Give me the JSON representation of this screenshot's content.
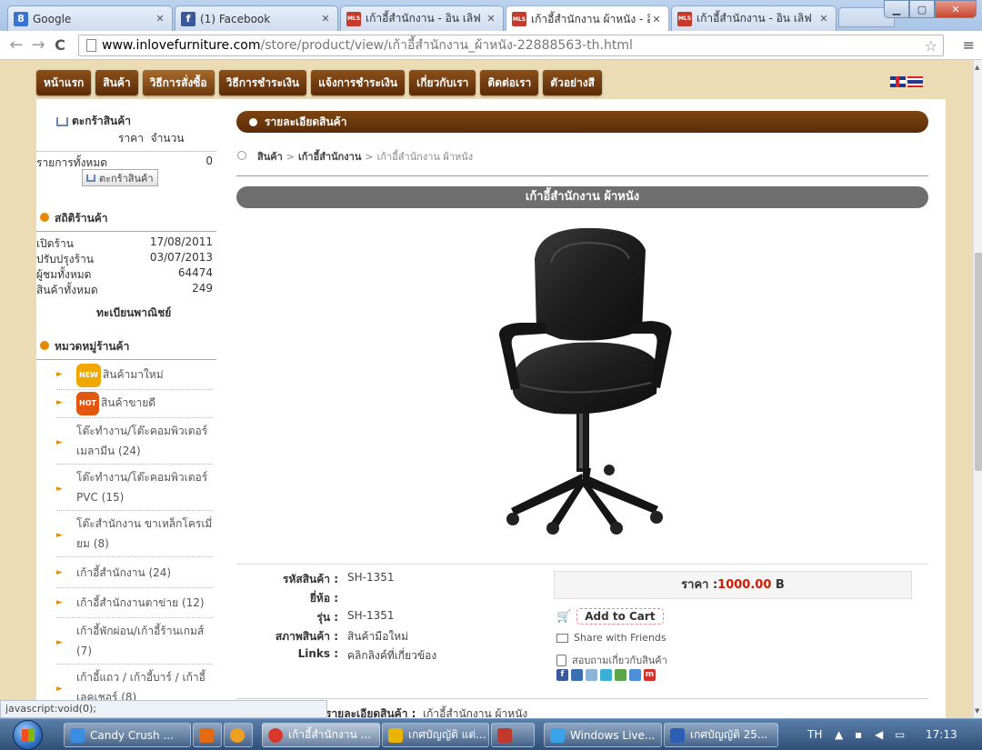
{
  "browser": {
    "tabs": [
      {
        "title": "Google",
        "fav_text": "8",
        "fav_color": "#3b73d1"
      },
      {
        "title": "(1) Facebook",
        "fav_text": "f",
        "fav_color": "#3b5998"
      },
      {
        "title": "เก้าอี้สำนักงาน - อิน เลิฟ",
        "fav_text": "MLS",
        "fav_color": "#c53a2a"
      },
      {
        "title": "เก้าอี้สำนักงาน ผ้าหนัง - อิ",
        "fav_text": "MLS",
        "fav_color": "#c53a2a"
      },
      {
        "title": "เก้าอี้สำนักงาน - อิน เลิฟ",
        "fav_text": "MLS",
        "fav_color": "#c53a2a"
      }
    ],
    "url_host": "www.inlovefurniture.com",
    "url_path": "/store/product/view/เก้าอี้สำนักงาน_ผ้าหนัง-22888563-th.html",
    "status_text": "javascript:void(0);"
  },
  "menu": [
    "หน้าแรก",
    "สินค้า",
    "วิธีการสั่งซื้อ",
    "วิธีการชำระเงิน",
    "แจ้งการชำระเงิน",
    "เกี่ยวกับเรา",
    "ติดต่อเรา",
    "ตัวอย่างสี"
  ],
  "sidebar": {
    "cart_title": "ตะกร้าสินค้า",
    "col_price": "ราคา",
    "col_qty": "จำนวน",
    "total_label": "รายการทั้งหมด",
    "total_count": "0",
    "cart_button": "ตะกร้าสินค้า",
    "stats_title": "สถิติร้านค้า",
    "stats": [
      {
        "label": "เปิดร้าน",
        "value": "17/08/2011"
      },
      {
        "label": "ปรับปรุงร้าน",
        "value": "03/07/2013"
      },
      {
        "label": "ผู้ชมทั้งหมด",
        "value": "64474"
      },
      {
        "label": "สินค้าทั้งหมด",
        "value": "249"
      }
    ],
    "registration": "ทะเบียนพาณิชย์",
    "categories_title": "หมวดหมู่ร้านค้า",
    "badge_new": "NEW",
    "badge_hot": "HOT",
    "categories": [
      "สินค้ามาใหม่",
      "สินค้าขายดี",
      "โต๊ะทำงาน/โต๊ะคอมพิวเตอร์ เมลามีน (24)",
      "โต๊ะทำงาน/โต๊ะคอมพิวเตอร์ PVC (15)",
      "โต๊ะสำนักงาน ขาเหล็กโครเมี่ยม (8)",
      "เก้าอี้สำนักงาน (24)",
      "เก้าอี้สำนักงานตาข่าย (12)",
      "เก้าอี้พักผ่อน/เก้าอี้ร้านเกมส์ (7)",
      "เก้าอี้แถว / เก้าอี้บาร์ / เก้าอี้เลคเชอร์ (8)"
    ]
  },
  "main": {
    "section_title": "รายละเอียดสินค้า",
    "breadcrumb": [
      "สินค้า",
      "เก้าอี้สำนักงาน",
      "เก้าอี้สำนักงาน ผ้าหนัง"
    ],
    "product_title": "เก้าอี้สำนักงาน ผ้าหนัง",
    "specs": [
      {
        "label": "รหัสสินค้า :",
        "value": "SH-1351"
      },
      {
        "label": "ยี่ห้อ :",
        "value": ""
      },
      {
        "label": "รุ่น :",
        "value": "SH-1351"
      },
      {
        "label": "สภาพสินค้า :",
        "value": "สินค้ามือใหม่"
      },
      {
        "label": "Links :",
        "value": "คลิกลิงค์ที่เกี่ยวข้อง"
      }
    ],
    "price_label": "ราคา :",
    "price_value": "1000.00",
    "price_unit": "B",
    "add_to_cart": "Add to Cart",
    "share": "Share with Friends",
    "ask": "สอบถามเกี่ยวกับสินค้า",
    "detail_label": "รายละเอียดสินค้า :",
    "detail_value": "เก้าอี้สำนักงาน ผ้าหนัง"
  },
  "taskbar": {
    "items": [
      {
        "label": "Candy Crush ...",
        "color": "#3a8de0"
      },
      {
        "label": "",
        "color": "#e46a12"
      },
      {
        "label": "",
        "color": "#f0a020"
      },
      {
        "label": "เก้าอี้สำนักงาน ...",
        "color": "#d9372c"
      },
      {
        "label": "เกศบัญญัติ แต่...",
        "color": "#e8b400"
      },
      {
        "label": "",
        "color": "#c0392b"
      },
      {
        "label": "Windows Live...",
        "color": "#3da3e8"
      },
      {
        "label": "เกศบัญญัติ 25...",
        "color": "#2b5fb3"
      }
    ],
    "lang": "TH",
    "clock": "17:13"
  }
}
